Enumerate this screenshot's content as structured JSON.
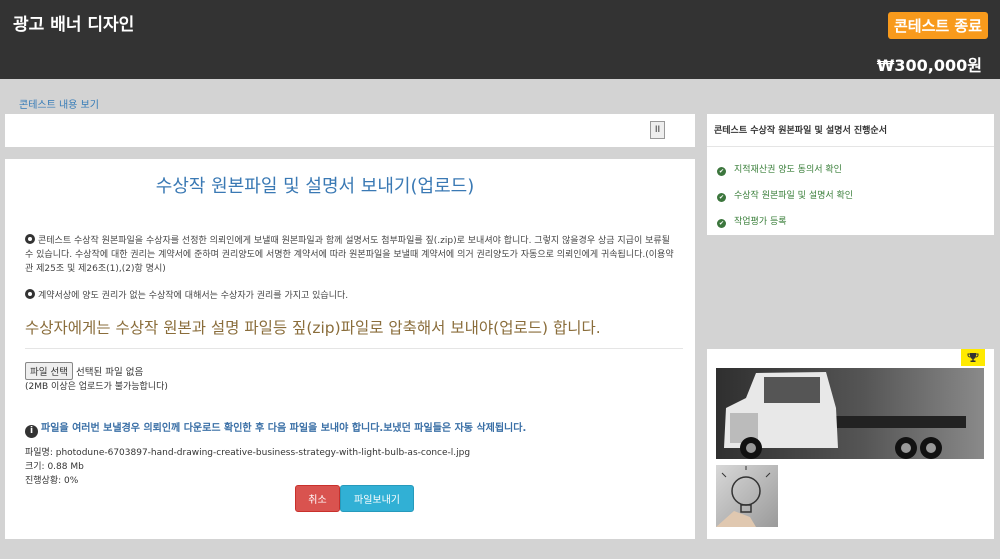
{
  "header": {
    "title": "광고 배너 디자인",
    "status_badge": "콘테스트 종료",
    "prize": "₩300,000원",
    "accent_color": "#f89a1c"
  },
  "breadcrumb": {
    "link_label": "콘테스트 내용 보기"
  },
  "top_panel": {
    "pause_label": "II"
  },
  "main": {
    "title": "수상작 원본파일 및 설명서 보내기(업로드)",
    "notice1": "콘테스트 수상작 원본파일을 수상자를 선정한 의뢰인에게 보낼때 원본파일과 함께 설명서도 첨부파일를 짚(.zip)로 보내셔야 합니다. 그렇지 않을경우 상금 지급이 보류될 수 있습니다. 수상작에 대한 권리는 계약서에 준하며 권리양도에 서명한 계약서에 따라 원본파일을 보낼때 계약서에 의거 권리양도가 자동으로 의뢰인에게 귀속됩니다.(이용약관 제25조 및 제26조(1),(2)항 명시)",
    "notice2": "계약서상에 양도 권리가 없는 수상작에 대해서는 수상자가 권리를 가지고 있습니다.",
    "big_notice": "수상자에게는 수상작 원본과 설명 파일등 짚(zip)파일로 압축해서 보내야(업로드) 합니다.",
    "file_button": "파일 선택",
    "file_status": "선택된 파일 없음",
    "size_note": "(2MB 이상은 업로드가 불가능합니다)",
    "info_line": "파일을 여러번 보낼경우 의뢰인께 다운로드 확인한 후 다음 파일을 보내야 합니다.보냈던 파일들은 자동 삭제됩니다.",
    "file_name": "파일명: photodune-6703897-hand-drawing-creative-business-strategy-with-light-bulb-as-conce-l.jpg",
    "file_size": "크기: 0.88 Mb",
    "progress": "진행상황: 0%",
    "cancel_label": "취소",
    "send_label": "파일보내기"
  },
  "sidebar": {
    "title": "콘테스트 수상작 원본파일 및 설명서 진행순서",
    "steps": [
      {
        "label": "지적재산권 양도 동의서 확인"
      },
      {
        "label": "수상작 원본파일 및 설명서 확인"
      },
      {
        "label": "작업평가 등록"
      }
    ]
  },
  "gallery": {
    "trophy_icon": "trophy-icon"
  }
}
